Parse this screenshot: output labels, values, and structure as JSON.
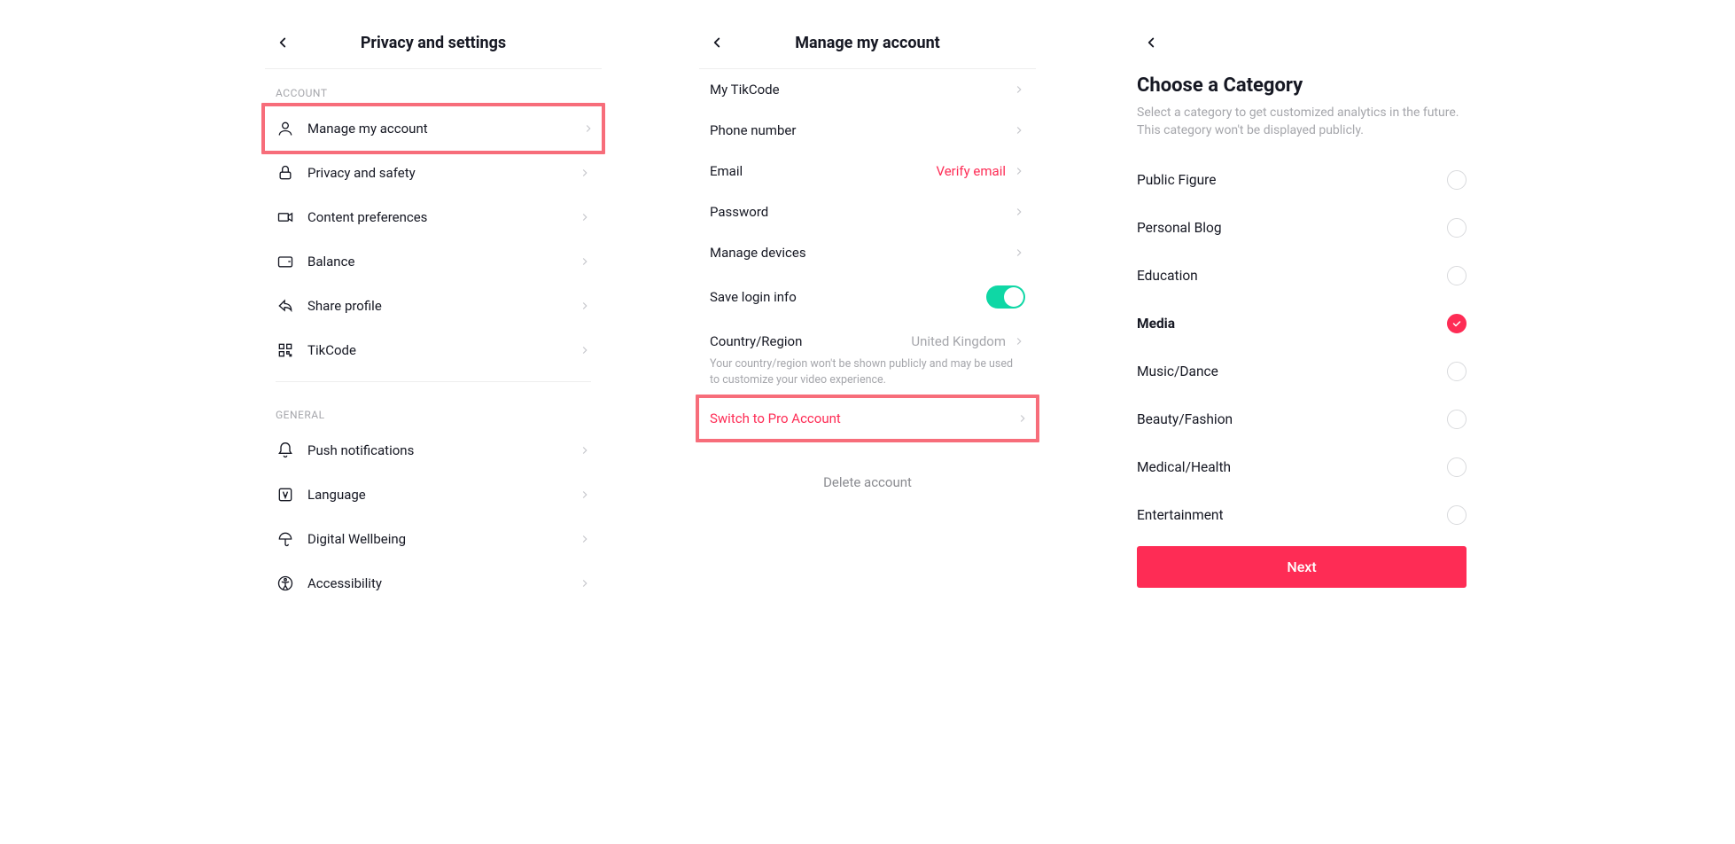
{
  "colors": {
    "accent": "#fe2c55",
    "highlight_border": "#f76d7a",
    "toggle_on": "#0fd7a5"
  },
  "screen1": {
    "title": "Privacy and settings",
    "sections": {
      "account": {
        "label": "ACCOUNT",
        "items": [
          {
            "icon": "user-icon",
            "label": "Manage my account",
            "highlighted": true
          },
          {
            "icon": "lock-icon",
            "label": "Privacy and safety"
          },
          {
            "icon": "video-icon",
            "label": "Content preferences"
          },
          {
            "icon": "wallet-icon",
            "label": "Balance"
          },
          {
            "icon": "share-icon",
            "label": "Share profile"
          },
          {
            "icon": "qr-icon",
            "label": "TikCode"
          }
        ]
      },
      "general": {
        "label": "GENERAL",
        "items": [
          {
            "icon": "bell-icon",
            "label": "Push notifications"
          },
          {
            "icon": "language-icon",
            "label": "Language"
          },
          {
            "icon": "umbrella-icon",
            "label": "Digital Wellbeing"
          },
          {
            "icon": "accessibility-icon",
            "label": "Accessibility"
          }
        ]
      }
    }
  },
  "screen2": {
    "title": "Manage my account",
    "items": {
      "tikcode": {
        "label": "My TikCode"
      },
      "phone": {
        "label": "Phone number"
      },
      "email": {
        "label": "Email",
        "value": "Verify email",
        "value_accent": true
      },
      "password": {
        "label": "Password"
      },
      "devices": {
        "label": "Manage devices"
      },
      "save_login": {
        "label": "Save login info",
        "toggle": true
      },
      "country": {
        "label": "Country/Region",
        "value": "United Kingdom"
      },
      "country_help": "Your country/region won't be shown publicly and may be used to customize your video experience.",
      "switch_pro": {
        "label": "Switch to Pro Account",
        "accent": true,
        "highlighted": true
      }
    },
    "delete": "Delete account"
  },
  "screen3": {
    "title": "Choose a Category",
    "subtitle": "Select a category to get customized analytics in the future. This category won't be displayed publicly.",
    "categories": [
      {
        "label": "Public Figure",
        "selected": false
      },
      {
        "label": "Personal Blog",
        "selected": false
      },
      {
        "label": "Education",
        "selected": false
      },
      {
        "label": "Media",
        "selected": true
      },
      {
        "label": "Music/Dance",
        "selected": false
      },
      {
        "label": "Beauty/Fashion",
        "selected": false
      },
      {
        "label": "Medical/Health",
        "selected": false
      },
      {
        "label": "Entertainment",
        "selected": false
      }
    ],
    "next": "Next"
  }
}
